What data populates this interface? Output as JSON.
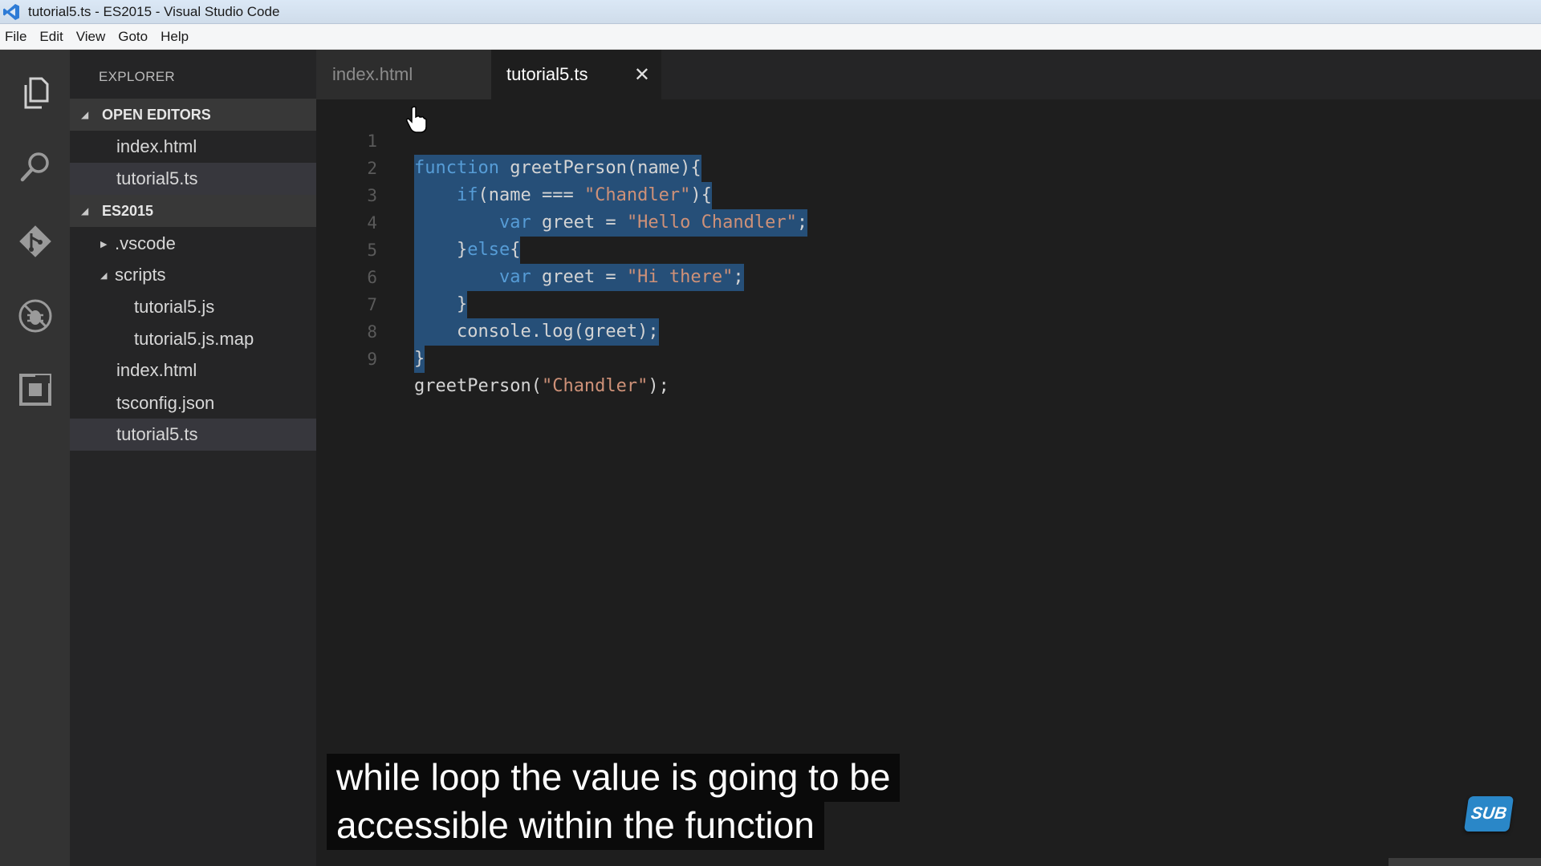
{
  "window": {
    "title": "tutorial5.ts - ES2015 - Visual Studio Code",
    "logo_icon": "vscode-logo"
  },
  "menu": [
    "File",
    "Edit",
    "View",
    "Goto",
    "Help"
  ],
  "activity_bar": [
    "files-icon",
    "search-icon",
    "git-icon",
    "debug-icon",
    "extensions-icon"
  ],
  "sidebar": {
    "title": "EXPLORER",
    "open_editors": {
      "label": "OPEN EDITORS",
      "items": [
        "index.html",
        "tutorial5.ts"
      ]
    },
    "project": {
      "label": "ES2015",
      "items": [
        {
          "label": ".vscode",
          "type": "folder-collapsed"
        },
        {
          "label": "scripts",
          "type": "folder-expanded"
        },
        {
          "label": "tutorial5.js",
          "type": "file"
        },
        {
          "label": "tutorial5.js.map",
          "type": "file"
        },
        {
          "label": "index.html",
          "type": "file"
        },
        {
          "label": "tsconfig.json",
          "type": "file"
        },
        {
          "label": "tutorial5.ts",
          "type": "file"
        }
      ]
    }
  },
  "tabs": [
    {
      "label": "index.html",
      "active": false
    },
    {
      "label": "tutorial5.ts",
      "active": true,
      "close": "✕"
    }
  ],
  "editor": {
    "line_numbers": [
      "1",
      "2",
      "3",
      "4",
      "5",
      "6",
      "7",
      "8",
      "9"
    ],
    "lines": [
      "function greetPerson(name){",
      "    if(name === \"Chandler\"){",
      "        var greet = \"Hello Chandler\";",
      "    }else{",
      "        var greet = \"Hi there\";",
      "    }",
      "    console.log(greet);",
      "}",
      "greetPerson(\"Chandler\");"
    ],
    "selected_lines": [
      1,
      8
    ]
  },
  "subtitle": {
    "line1": "while loop the value is going to be",
    "line2": "accessible within the function"
  },
  "badge": "SUB",
  "colors": {
    "keyword": "#569cd6",
    "string": "#ce9178",
    "selection": "#264f78",
    "sidebar_bg": "#252526",
    "editor_bg": "#1e1e1e",
    "activity_bg": "#333333"
  }
}
